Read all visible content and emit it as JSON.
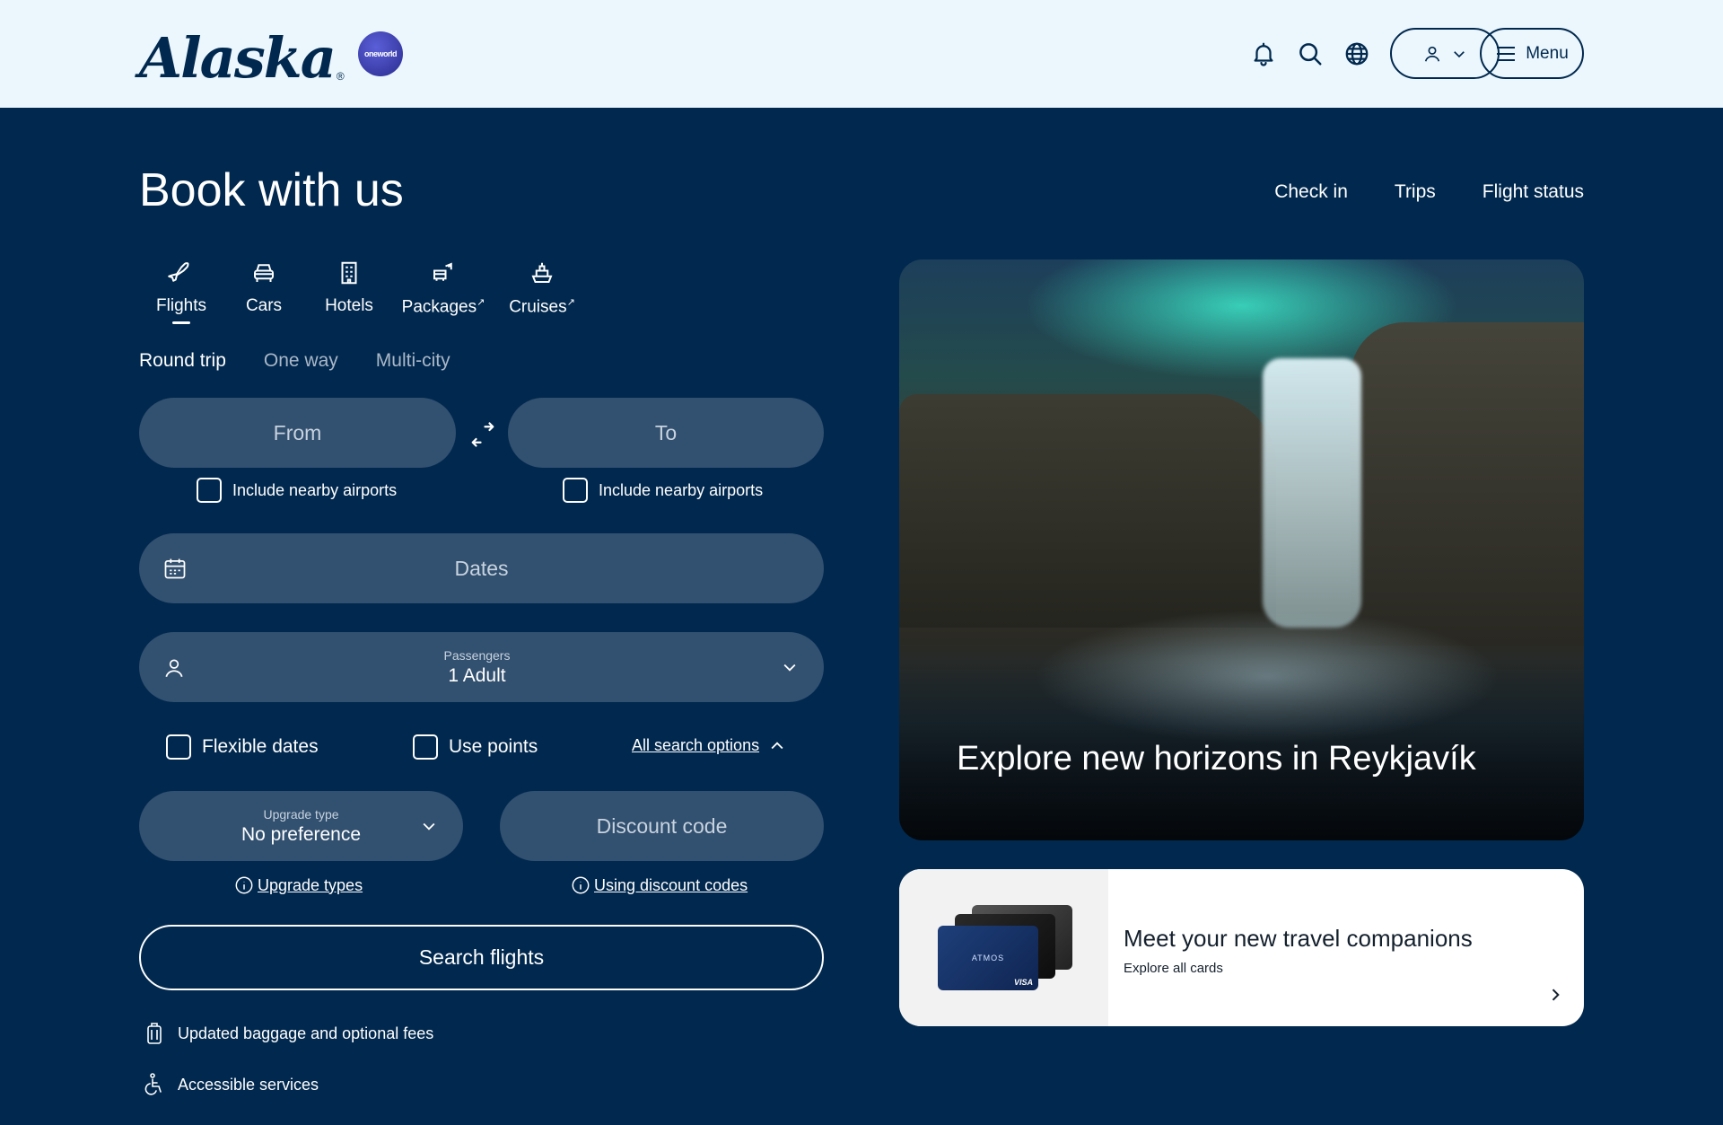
{
  "header": {
    "logo_text": "Alaska",
    "logo_mark": "®",
    "alliance_badge": "oneworld",
    "icons": [
      "bell-icon",
      "search-icon",
      "globe-icon",
      "user-icon"
    ],
    "menu_label": "Menu"
  },
  "page": {
    "title": "Book with us",
    "top_links": [
      "Check in",
      "Trips",
      "Flight status"
    ]
  },
  "categories": [
    {
      "label": "Flights",
      "icon": "plane-icon",
      "active": true
    },
    {
      "label": "Cars",
      "icon": "car-icon",
      "active": false
    },
    {
      "label": "Hotels",
      "icon": "building-icon",
      "active": false
    },
    {
      "label": "Packages",
      "icon": "package-icon",
      "active": false,
      "external": true
    },
    {
      "label": "Cruises",
      "icon": "ship-icon",
      "active": false,
      "external": true
    }
  ],
  "trip_types": [
    "Round trip",
    "One way",
    "Multi-city"
  ],
  "trip_type_selected": "Round trip",
  "form": {
    "from_placeholder": "From",
    "to_placeholder": "To",
    "nearby_from": "Include nearby airports",
    "nearby_to": "Include nearby airports",
    "dates_placeholder": "Dates",
    "passengers_label": "Passengers",
    "passengers_value": "1 Adult",
    "flexible_dates": "Flexible dates",
    "use_points": "Use points",
    "all_search_options": "All search options",
    "upgrade_label": "Upgrade type",
    "upgrade_value": "No preference",
    "discount_placeholder": "Discount code",
    "upgrade_types_link": "Upgrade types",
    "discount_link": "Using discount codes",
    "search_button": "Search flights"
  },
  "footer_links": [
    "Updated baggage and optional fees",
    "Accessible services"
  ],
  "hero": {
    "caption": "Explore new horizons in Reykjavík"
  },
  "promo": {
    "title": "Meet your new travel companions",
    "subtitle": "Explore all cards",
    "card_text": "ATMOS",
    "card_brand": "VISA"
  },
  "colors": {
    "navy": "#01284e",
    "field": "#32506f",
    "header_bg": "#ebf7fd"
  }
}
